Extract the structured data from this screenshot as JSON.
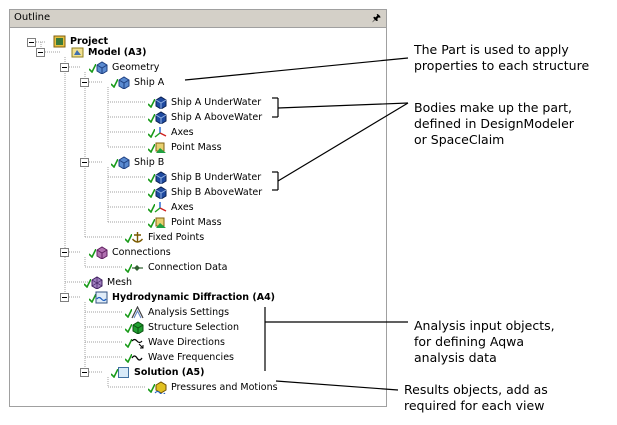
{
  "panel": {
    "title": "Outline",
    "pin_icon": "pin-icon"
  },
  "tree": {
    "project": "Project",
    "model": "Model (A3)",
    "geometry": "Geometry",
    "ship_a": "Ship A",
    "ship_a_underwater": "Ship A UnderWater",
    "ship_a_abovewater": "Ship A AboveWater",
    "axes_a": "Axes",
    "point_mass_a": "Point Mass",
    "ship_b": "Ship B",
    "ship_b_underwater": "Ship B UnderWater",
    "ship_b_abovewater": "Ship B AboveWater",
    "axes_b": "Axes",
    "point_mass_b": "Point Mass",
    "fixed_points": "Fixed Points",
    "connections": "Connections",
    "connection_data": "Connection Data",
    "mesh": "Mesh",
    "hydro": "Hydrodynamic Diffraction (A4)",
    "analysis_settings": "Analysis Settings",
    "structure_selection": "Structure Selection",
    "wave_directions": "Wave Directions",
    "wave_frequencies": "Wave Frequencies",
    "solution": "Solution (A5)",
    "pressures": "Pressures and Motions"
  },
  "annotations": {
    "part": [
      "The Part is used to apply",
      "properties to each structure"
    ],
    "bodies": [
      "Bodies make up the part,",
      "defined in DesignModeler",
      "or SpaceClaim"
    ],
    "analysis": [
      "Analysis input objects,",
      "for defining Aqwa",
      "analysis data"
    ],
    "results": [
      "Results objects, add as",
      "required for each view"
    ]
  },
  "colors": {
    "check": "#1a9b1a",
    "geometry_icon": "#2a5ea8",
    "titlebar": "#d4d0c8"
  }
}
